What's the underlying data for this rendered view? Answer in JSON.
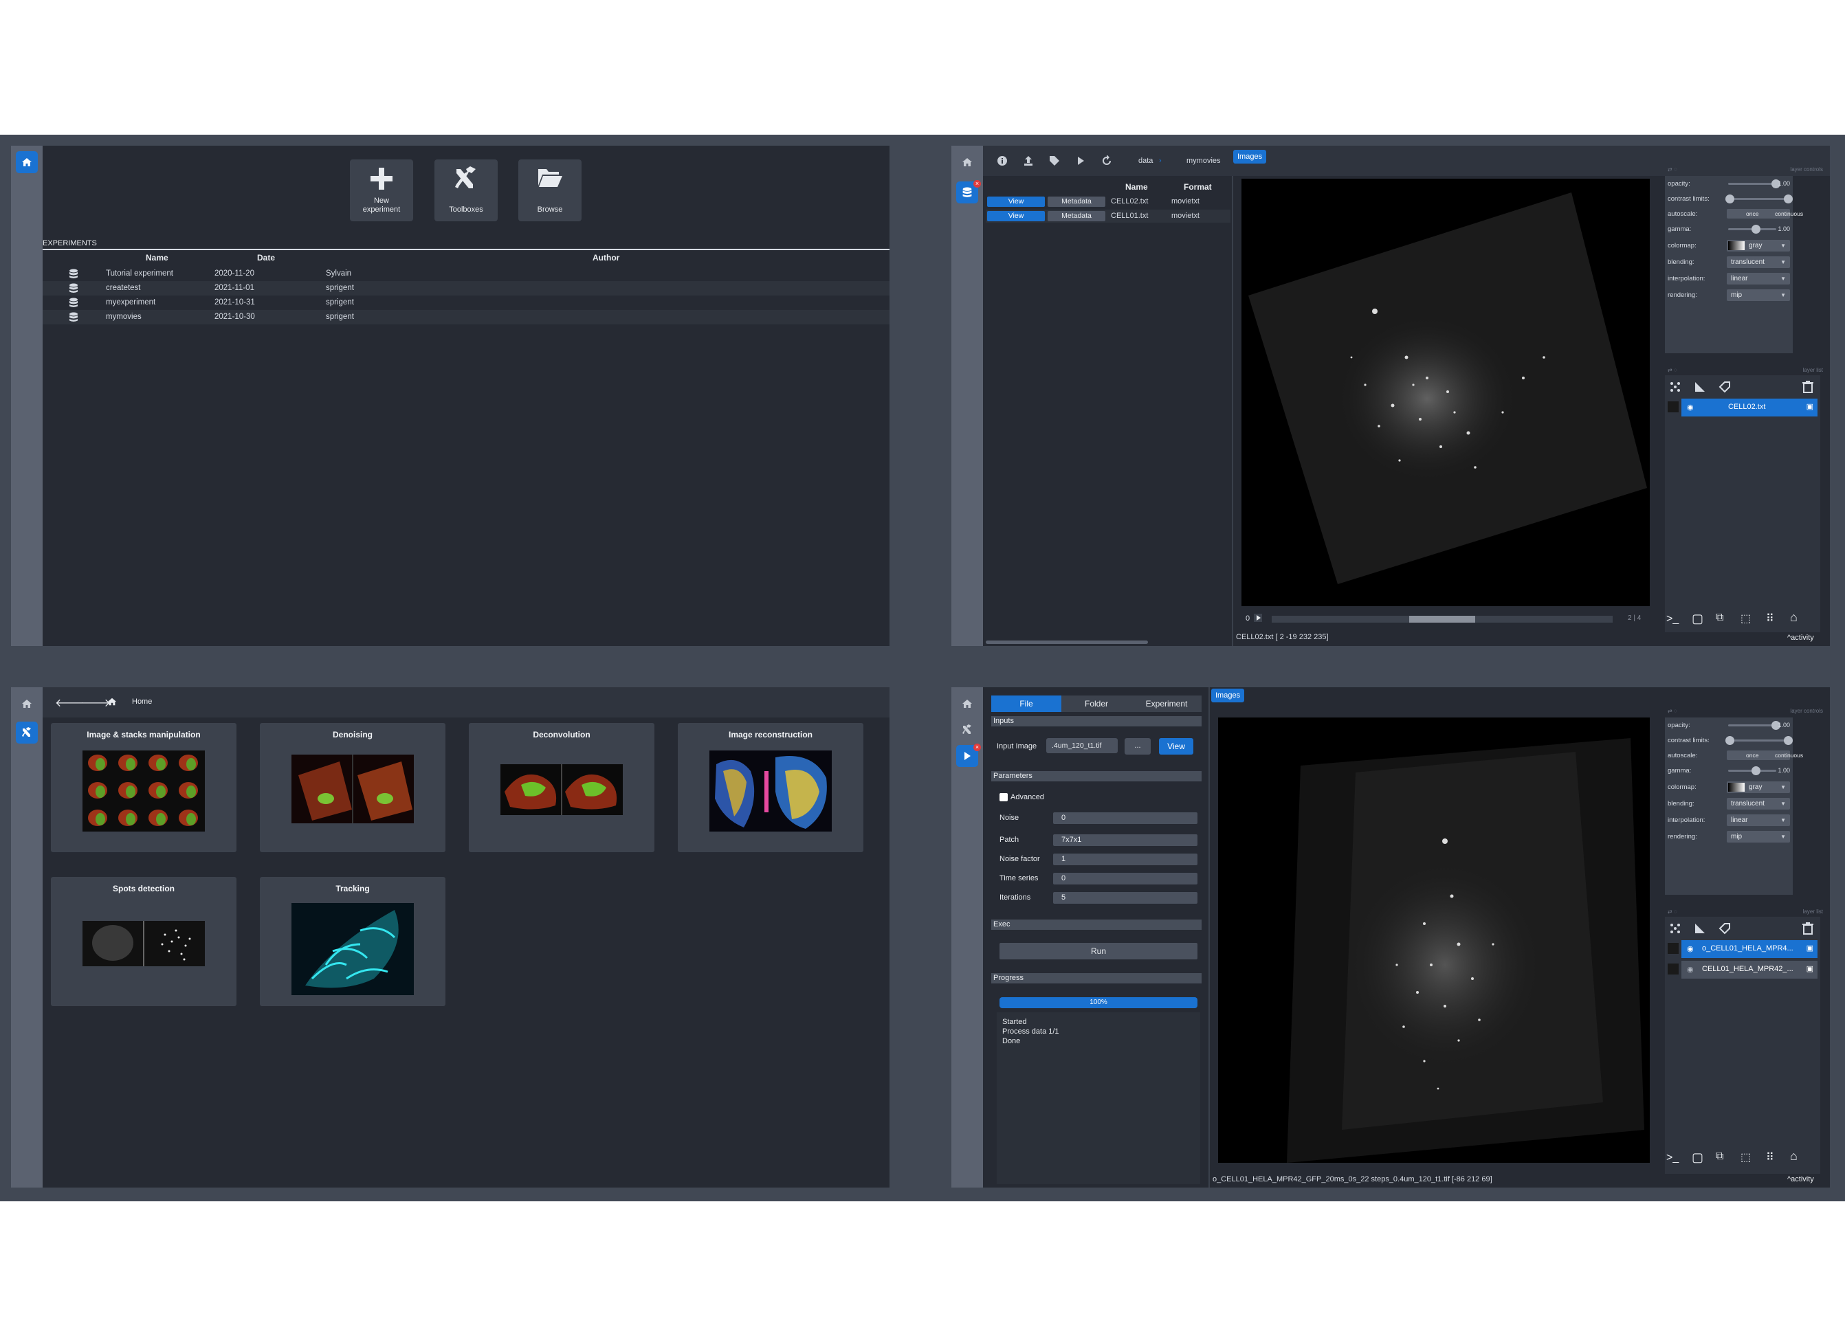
{
  "panel1": {
    "tools": [
      {
        "icon": "plus-icon",
        "label_line1": "New",
        "label_line2": "experiment"
      },
      {
        "icon": "toolboxes-icon",
        "label_line1": "Toolboxes",
        "label_line2": ""
      },
      {
        "icon": "folder-open-icon",
        "label_line1": "Browse",
        "label_line2": ""
      }
    ],
    "experiments_header": "EXPERIMENTS",
    "columns": {
      "name": "Name",
      "date": "Date",
      "author": "Author"
    },
    "rows": [
      {
        "name": "Tutorial experiment",
        "date": "2020-11-20",
        "author": "Sylvain"
      },
      {
        "name": "createtest",
        "date": "2021-11-01",
        "author": "sprigent"
      },
      {
        "name": "myexperiment",
        "date": "2021-10-31",
        "author": "sprigent"
      },
      {
        "name": "mymovies",
        "date": "2021-10-30",
        "author": "sprigent"
      }
    ]
  },
  "panel2": {
    "breadcrumb": [
      "data",
      "mymovies"
    ],
    "images_tab": "Images",
    "columns": {
      "name": "Name",
      "format": "Format"
    },
    "rows": [
      {
        "view": "View",
        "metadata": "Metadata",
        "name": "CELL02.txt",
        "format": "movietxt"
      },
      {
        "view": "View",
        "metadata": "Metadata",
        "name": "CELL01.txt",
        "format": "movietxt"
      }
    ],
    "frame_index": "0",
    "frame_counter": "2 | 4",
    "status": "CELL02.txt [  2 -19 232 235]",
    "activity": "activity",
    "layer_controls": {
      "opacity_label": "opacity:",
      "opacity_value": "1.00",
      "contrast_label": "contrast limits:",
      "autoscale_label": "autoscale:",
      "autoscale_once": "once",
      "autoscale_continuous": "continuous",
      "gamma_label": "gamma:",
      "gamma_value": "1.00",
      "colormap_label": "colormap:",
      "colormap": "gray",
      "blending_label": "blending:",
      "blending": "translucent",
      "interpolation_label": "interpolation:",
      "interpolation": "linear",
      "rendering_label": "rendering:",
      "rendering": "mip"
    },
    "layers": [
      {
        "name": "CELL02.txt",
        "selected": true
      }
    ]
  },
  "panel3": {
    "breadcrumb": "Home",
    "cards": [
      {
        "title": "Image & stacks manipulation"
      },
      {
        "title": "Denoising"
      },
      {
        "title": "Deconvolution"
      },
      {
        "title": "Image reconstruction"
      },
      {
        "title": "Spots detection"
      },
      {
        "title": "Tracking"
      }
    ]
  },
  "panel4": {
    "tabs": [
      "File",
      "Folder",
      "Experiment"
    ],
    "images_tab": "Images",
    "sections": {
      "inputs": "Inputs",
      "parameters": "Parameters",
      "exec": "Exec",
      "progress": "Progress"
    },
    "input_image_label": "Input Image",
    "input_image_value": ".4um_120_t1.tif",
    "browse_button": "...",
    "view_button": "View",
    "advanced_label": "Advanced",
    "params": [
      {
        "label": "Noise",
        "value": "0"
      },
      {
        "label": "Patch",
        "value": "7x7x1"
      },
      {
        "label": "Noise factor",
        "value": "1"
      },
      {
        "label": "Time series",
        "value": "0"
      },
      {
        "label": "Iterations",
        "value": "5"
      }
    ],
    "run_button": "Run",
    "progress": "100%",
    "progress_value": 1.0,
    "log": [
      "Started",
      "Process data 1/1",
      "Done"
    ],
    "status": "o_CELL01_HELA_MPR42_GFP_20ms_0s_22 steps_0.4um_120_t1.tif [-86 212  69]",
    "activity": "activity",
    "layer_controls": {
      "opacity_label": "opacity:",
      "opacity_value": "1.00",
      "contrast_label": "contrast limits:",
      "autoscale_label": "autoscale:",
      "autoscale_once": "once",
      "autoscale_continuous": "continuous",
      "gamma_label": "gamma:",
      "gamma_value": "1.00",
      "colormap_label": "colormap:",
      "colormap": "gray",
      "blending_label": "blending:",
      "blending": "translucent",
      "interpolation_label": "interpolation:",
      "interpolation": "linear",
      "rendering_label": "rendering:",
      "rendering": "mip"
    },
    "layers": [
      {
        "name": "o_CELL01_HELA_MPR4...",
        "selected": true
      },
      {
        "name": "CELL01_HELA_MPR42_...",
        "selected": false
      }
    ]
  },
  "colors": {
    "accent": "#1a72d1",
    "panel_bg": "#262a33",
    "sidebar_bg": "#5b6270",
    "danger": "#e23b3b"
  }
}
